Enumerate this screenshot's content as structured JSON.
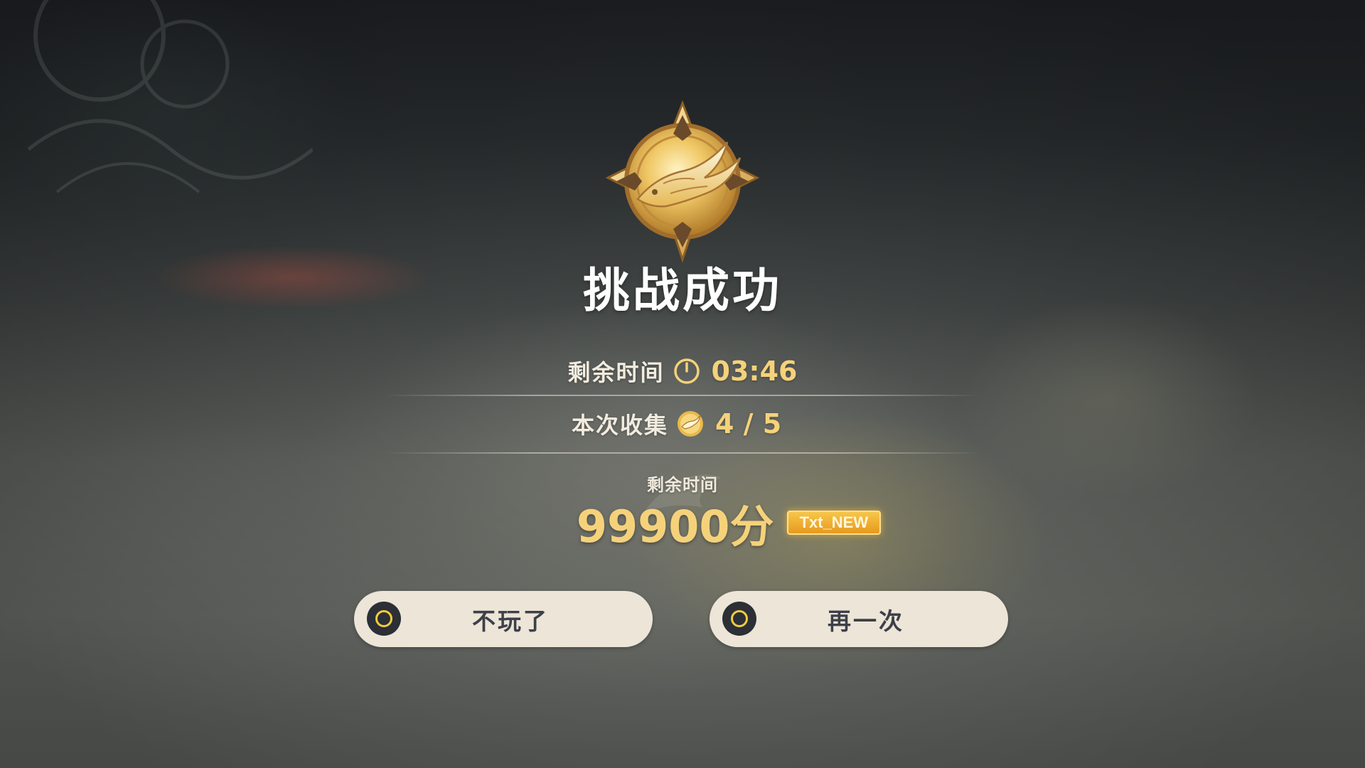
{
  "result": {
    "title": "挑战成功",
    "emblem_icon": "golden-bird-emblem-icon"
  },
  "stats": {
    "time_remaining": {
      "label": "剩余时间",
      "icon": "clock-icon",
      "value": "03:46"
    },
    "collected": {
      "label": "本次收集",
      "icon": "bird-coin-icon",
      "value": "4 / 5"
    }
  },
  "score": {
    "label": "剩余时间",
    "value": "99900分",
    "badge": "Txt_NEW"
  },
  "buttons": {
    "quit": {
      "label": "不玩了",
      "key_icon": "controller-circle-button-icon"
    },
    "retry": {
      "label": "再一次",
      "key_icon": "controller-circle-button-icon"
    }
  },
  "colors": {
    "accent_gold": "#f5d27a",
    "button_bg": "#ece5d8",
    "button_text": "#3d4049",
    "badge_orange": "#e79a1d"
  }
}
